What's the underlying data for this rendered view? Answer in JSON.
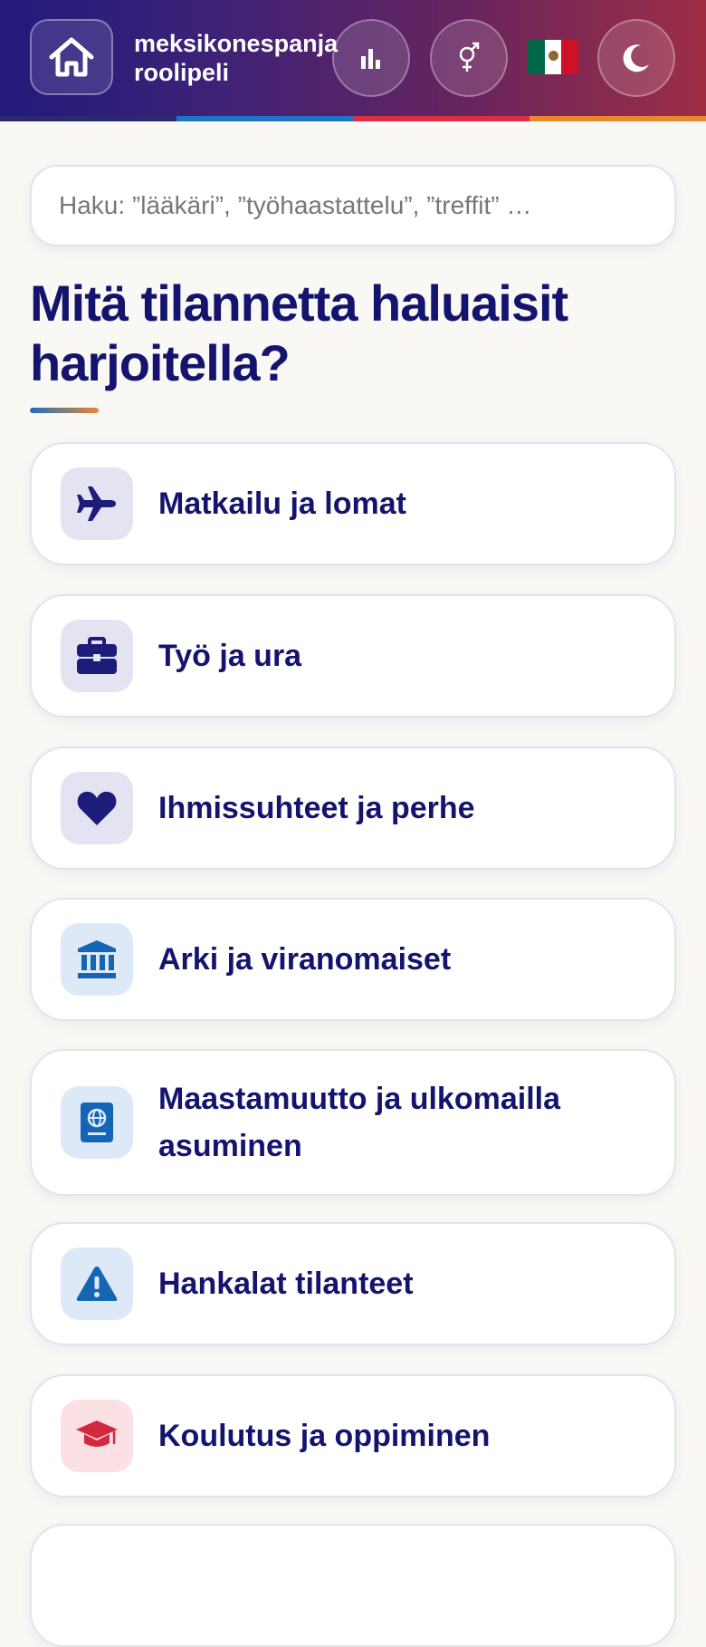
{
  "header": {
    "brand_line1": "meksikonespanja",
    "brand_line2": "roolipeli",
    "stripe_colors": [
      "#2a2a6e",
      "#1f74c4",
      "#dc2f45",
      "#e6892f"
    ],
    "flag_colors": [
      "#006847",
      "#ffffff",
      "#ce1126"
    ]
  },
  "search": {
    "placeholder": "Haku: ”lääkäri”, ”työhaastattelu”, ”treffit” …"
  },
  "page": {
    "heading": "Mitä tilannetta haluaisit harjoitella?"
  },
  "categories": [
    {
      "label": "Matkailu ja lomat",
      "icon": "plane-icon",
      "tint": "#e4e3f2",
      "color": "#1d1c78"
    },
    {
      "label": "Työ ja ura",
      "icon": "briefcase-icon",
      "tint": "#e4e3f2",
      "color": "#1d1c78"
    },
    {
      "label": "Ihmissuhteet ja perhe",
      "icon": "heart-icon",
      "tint": "#e4e3f2",
      "color": "#1d1c78"
    },
    {
      "label": "Arki ja viranomaiset",
      "icon": "government-building-icon",
      "tint": "#dde9f6",
      "color": "#1466b5"
    },
    {
      "label": "Maastamuutto ja ulkomailla asuminen",
      "icon": "passport-icon",
      "tint": "#dde9f6",
      "color": "#1466b5"
    },
    {
      "label": "Hankalat tilanteet",
      "icon": "warning-icon",
      "tint": "#dde9f6",
      "color": "#1466b5"
    },
    {
      "label": "Koulutus ja oppiminen",
      "icon": "graduation-cap-icon",
      "tint": "#fbe1e4",
      "color": "#d3293f"
    }
  ]
}
